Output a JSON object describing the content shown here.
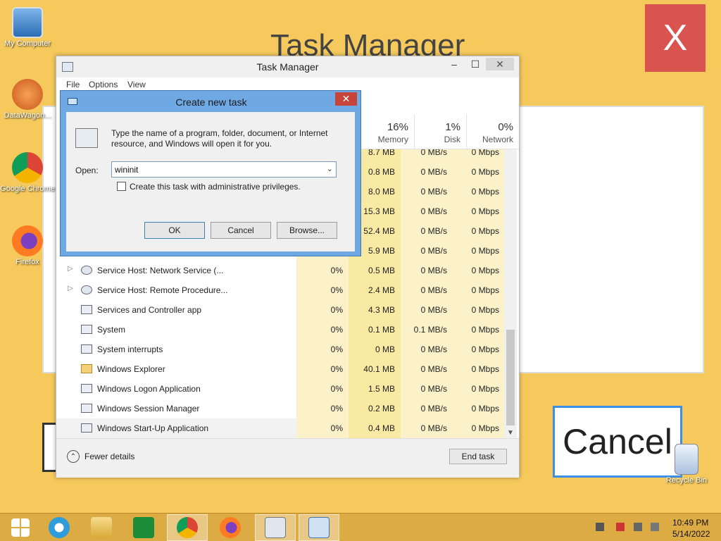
{
  "background_app": {
    "title": "Task Manager",
    "close_label": "X",
    "cancel_label": "Cancel"
  },
  "desktop_icons": [
    {
      "label": "My Computer"
    },
    {
      "label": "DataWagon..."
    },
    {
      "label": "Google Chrome"
    },
    {
      "label": "Firefox"
    },
    {
      "label": "Recycle Bin"
    }
  ],
  "task_manager": {
    "title": "Task Manager",
    "menu": [
      "File",
      "Options",
      "View"
    ],
    "columns": [
      {
        "pct": "16%",
        "label": "Memory"
      },
      {
        "pct": "1%",
        "label": "Disk"
      },
      {
        "pct": "0%",
        "label": "Network"
      }
    ],
    "rows": [
      {
        "name": "",
        "cpu": "",
        "mem": "8.7 MB",
        "disk": "0 MB/s",
        "net": "0 Mbps",
        "icon": "app"
      },
      {
        "name": "",
        "cpu": "",
        "mem": "0.8 MB",
        "disk": "0 MB/s",
        "net": "0 Mbps",
        "icon": "app"
      },
      {
        "name": "",
        "cpu": "",
        "mem": "8.0 MB",
        "disk": "0 MB/s",
        "net": "0 Mbps",
        "icon": "app"
      },
      {
        "name": "",
        "cpu": "",
        "mem": "15.3 MB",
        "disk": "0 MB/s",
        "net": "0 Mbps",
        "icon": "app"
      },
      {
        "name": "",
        "cpu": "",
        "mem": "52.4 MB",
        "disk": "0 MB/s",
        "net": "0 Mbps",
        "icon": "app"
      },
      {
        "name": "",
        "cpu": "",
        "mem": "5.9 MB",
        "disk": "0 MB/s",
        "net": "0 Mbps",
        "icon": "app"
      },
      {
        "name": "Service Host: Network Service (...",
        "cpu": "0%",
        "mem": "0.5 MB",
        "disk": "0 MB/s",
        "net": "0 Mbps",
        "icon": "gear",
        "expand": true
      },
      {
        "name": "Service Host: Remote Procedure...",
        "cpu": "0%",
        "mem": "2.4 MB",
        "disk": "0 MB/s",
        "net": "0 Mbps",
        "icon": "gear",
        "expand": true
      },
      {
        "name": "Services and Controller app",
        "cpu": "0%",
        "mem": "4.3 MB",
        "disk": "0 MB/s",
        "net": "0 Mbps",
        "icon": "app"
      },
      {
        "name": "System",
        "cpu": "0%",
        "mem": "0.1 MB",
        "disk": "0.1 MB/s",
        "net": "0 Mbps",
        "icon": "app"
      },
      {
        "name": "System interrupts",
        "cpu": "0%",
        "mem": "0 MB",
        "disk": "0 MB/s",
        "net": "0 Mbps",
        "icon": "app"
      },
      {
        "name": "Windows Explorer",
        "cpu": "0%",
        "mem": "40.1 MB",
        "disk": "0 MB/s",
        "net": "0 Mbps",
        "icon": "folder"
      },
      {
        "name": "Windows Logon Application",
        "cpu": "0%",
        "mem": "1.5 MB",
        "disk": "0 MB/s",
        "net": "0 Mbps",
        "icon": "app"
      },
      {
        "name": "Windows Session Manager",
        "cpu": "0%",
        "mem": "0.2 MB",
        "disk": "0 MB/s",
        "net": "0 Mbps",
        "icon": "app"
      },
      {
        "name": "Windows Start-Up Application",
        "cpu": "0%",
        "mem": "0.4 MB",
        "disk": "0 MB/s",
        "net": "0 Mbps",
        "icon": "app",
        "selected": true
      }
    ],
    "fewer_details": "Fewer details",
    "end_task": "End task"
  },
  "dialog": {
    "title": "Create new task",
    "close": "✕",
    "description": "Type the name of a program, folder, document, or Internet resource, and Windows will open it for you.",
    "open_label": "Open:",
    "open_value": "wininit",
    "admin_label": "Create this task with administrative privileges.",
    "ok": "OK",
    "cancel": "Cancel",
    "browse": "Browse..."
  },
  "taskbar": {
    "time": "10:49 PM",
    "date": "5/14/2022"
  },
  "colors": {
    "dialog_frame": "#6fa9e3",
    "cpu_column": "#fbf2c9",
    "memory_column": "#f8e9a3",
    "taskbar": "#dcab43"
  }
}
